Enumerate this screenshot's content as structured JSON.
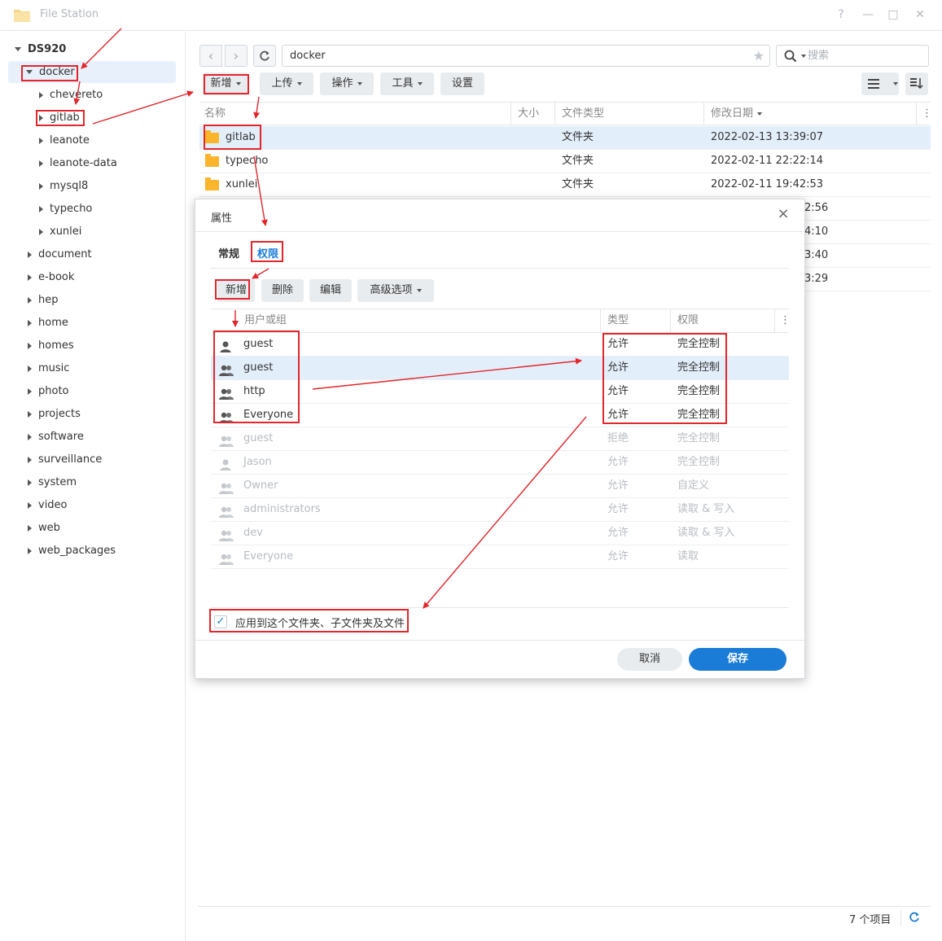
{
  "window": {
    "title": "File Station",
    "help": "?",
    "minimize": "—",
    "maximize": "□",
    "close": "✕"
  },
  "sidebar": {
    "root": "DS920",
    "docker": "docker",
    "docker_children": [
      "chevereto",
      "gitlab",
      "leanote",
      "leanote-data",
      "mysql8",
      "typecho",
      "xunlei"
    ],
    "folders": [
      "document",
      "e-book",
      "hep",
      "home",
      "homes",
      "music",
      "photo",
      "projects",
      "software",
      "surveillance",
      "system",
      "video",
      "web",
      "web_packages"
    ]
  },
  "toolbar": {
    "path": "docker",
    "search_placeholder": "搜索",
    "new": "新增",
    "upload": "上传",
    "action": "操作",
    "tools": "工具",
    "settings": "设置"
  },
  "file_list": {
    "columns": [
      "名称",
      "大小",
      "文件类型",
      "修改日期"
    ],
    "rows": [
      {
        "name": "gitlab",
        "type": "文件夹",
        "date": "2022-02-13 13:39:07"
      },
      {
        "name": "typecho",
        "type": "文件夹",
        "date": "2022-02-11 22:22:14"
      },
      {
        "name": "xunlei",
        "type": "文件夹",
        "date": "2022-02-11 19:42:53"
      }
    ],
    "partial_dates": [
      "2:56",
      "4:10",
      "3:40",
      "3:29"
    ],
    "item_count": "7 个项目"
  },
  "dialog": {
    "title": "属性",
    "tabs": [
      "常规",
      "权限"
    ],
    "buttons": [
      "新增",
      "删除",
      "编辑",
      "高级选项"
    ],
    "columns": [
      "用户或组",
      "类型",
      "权限"
    ],
    "rows": [
      {
        "name": "guest",
        "type": "允许",
        "perm": "完全控制",
        "icon": "user-icon"
      },
      {
        "name": "guest",
        "type": "允许",
        "perm": "完全控制",
        "icon": "group-icon"
      },
      {
        "name": "http",
        "type": "允许",
        "perm": "完全控制",
        "icon": "group-icon"
      },
      {
        "name": "Everyone",
        "type": "允许",
        "perm": "完全控制",
        "icon": "group-icon"
      },
      {
        "name": "guest",
        "type": "拒绝",
        "perm": "完全控制",
        "icon": "group-icon"
      },
      {
        "name": "Jason",
        "type": "允许",
        "perm": "完全控制",
        "icon": "user-icon"
      },
      {
        "name": "Owner",
        "type": "允许",
        "perm": "自定义",
        "icon": "group-icon"
      },
      {
        "name": "administrators",
        "type": "允许",
        "perm": "读取 & 写入",
        "icon": "group-icon"
      },
      {
        "name": "dev",
        "type": "允许",
        "perm": "读取 & 写入",
        "icon": "group-icon"
      },
      {
        "name": "Everyone",
        "type": "允许",
        "perm": "读取",
        "icon": "group-icon"
      }
    ],
    "apply_label": "应用到这个文件夹、子文件夹及文件",
    "cancel": "取消",
    "save": "保存"
  },
  "colors": {
    "accent": "#1a7cd6",
    "annotation": "#e2262c",
    "folder": "#f9b52b"
  }
}
